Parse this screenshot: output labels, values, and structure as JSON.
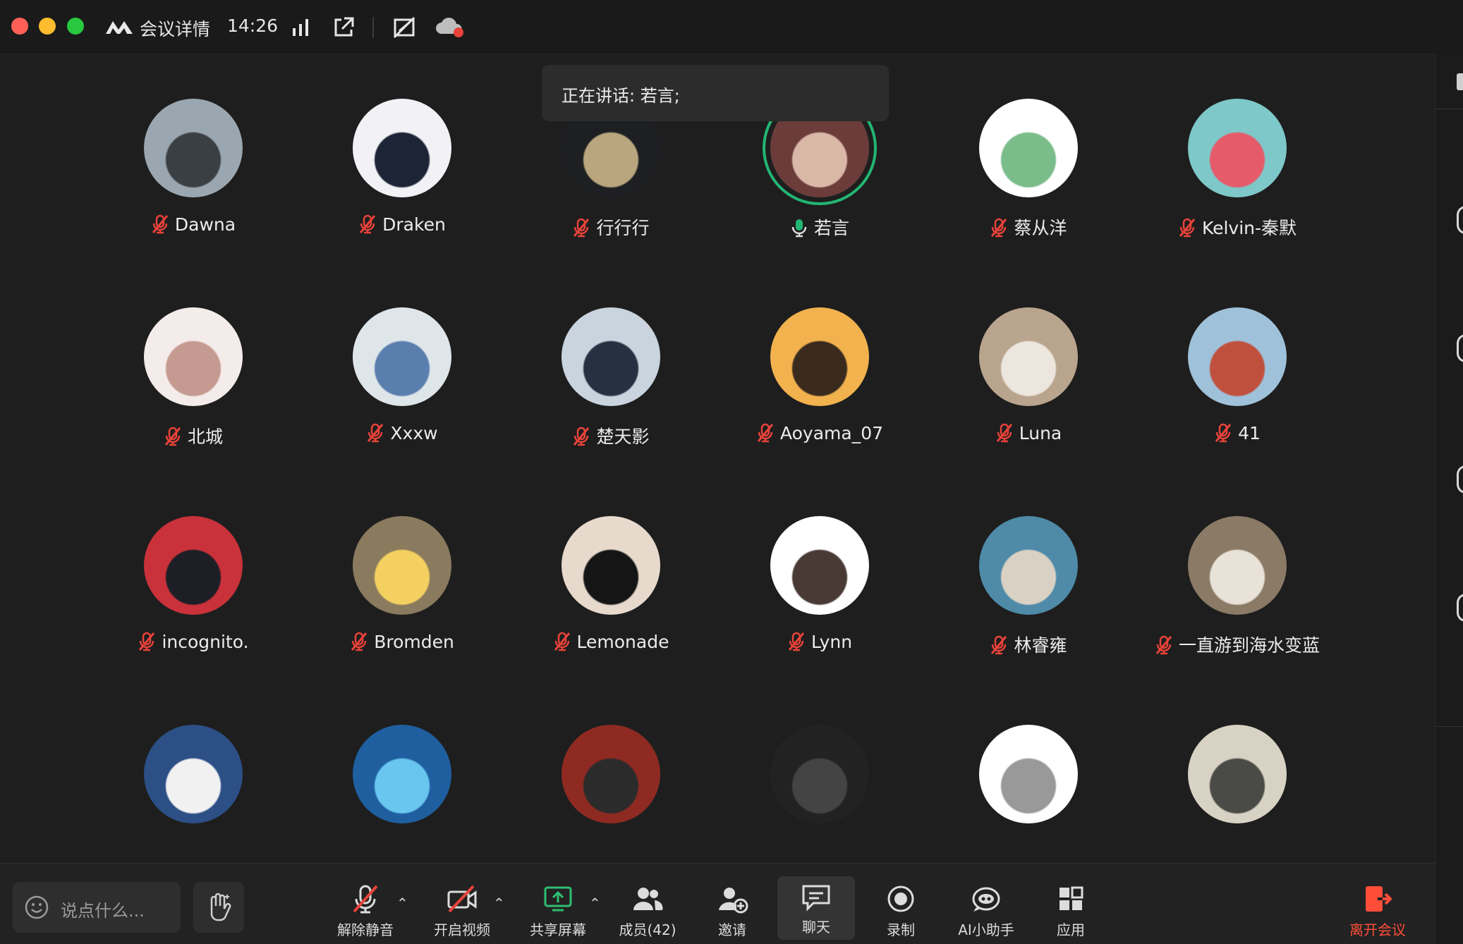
{
  "titlebar": {
    "title": "会议详情",
    "time": "14:26"
  },
  "speaking_banner": {
    "text": "正在讲话: 若言;"
  },
  "participants": [
    {
      "name": "Dawna",
      "mic": "muted",
      "avatar_colors": [
        "#9aa7b0",
        "#3a3f44"
      ]
    },
    {
      "name": "Draken",
      "mic": "muted",
      "avatar_colors": [
        "#f2f2f6",
        "#1d2436"
      ]
    },
    {
      "name": "行行行",
      "mic": "muted",
      "avatar_colors": [
        "#1d1f22",
        "#b9a67e"
      ]
    },
    {
      "name": "若言",
      "mic": "speaking",
      "avatar_colors": [
        "#6b3c3a",
        "#d9b8a8"
      ]
    },
    {
      "name": "蔡从洋",
      "mic": "muted",
      "avatar_colors": [
        "#ffffff",
        "#7bbd8a"
      ]
    },
    {
      "name": "Kelvin-秦默",
      "mic": "muted",
      "avatar_colors": [
        "#7ec8c9",
        "#e55b6a"
      ]
    },
    {
      "name": "北城",
      "mic": "muted",
      "avatar_colors": [
        "#f4ecea",
        "#c59a90"
      ]
    },
    {
      "name": "Xxxw",
      "mic": "muted",
      "avatar_colors": [
        "#dfe6ea",
        "#5a7fae"
      ]
    },
    {
      "name": "楚天影",
      "mic": "muted",
      "avatar_colors": [
        "#c9d4de",
        "#263040"
      ]
    },
    {
      "name": "Aoyama_07",
      "mic": "muted",
      "avatar_colors": [
        "#f2b24e",
        "#3a2a1e"
      ]
    },
    {
      "name": "Luna",
      "mic": "muted",
      "avatar_colors": [
        "#b9a48e",
        "#ece6de"
      ]
    },
    {
      "name": "41",
      "mic": "muted",
      "avatar_colors": [
        "#9fc1d9",
        "#c0503e"
      ]
    },
    {
      "name": "incognito.",
      "mic": "muted",
      "avatar_colors": [
        "#c9323a",
        "#1e1e26"
      ]
    },
    {
      "name": "Bromden",
      "mic": "muted",
      "avatar_colors": [
        "#8a7a5e",
        "#f4d060"
      ]
    },
    {
      "name": "Lemonade",
      "mic": "muted",
      "avatar_colors": [
        "#e7d9cc",
        "#151515"
      ]
    },
    {
      "name": "Lynn",
      "mic": "muted",
      "avatar_colors": [
        "#ffffff",
        "#4a3a36"
      ]
    },
    {
      "name": "林睿雍",
      "mic": "muted",
      "avatar_colors": [
        "#4f8aa8",
        "#d9d2c4"
      ]
    },
    {
      "name": "一直游到海水变蓝",
      "mic": "muted",
      "avatar_colors": [
        "#8a7a66",
        "#e8e2d8"
      ]
    },
    {
      "name": "",
      "mic": "none",
      "avatar_colors": [
        "#2c4f86",
        "#f1f1f1"
      ]
    },
    {
      "name": "",
      "mic": "none",
      "avatar_colors": [
        "#1f5fa0",
        "#68c6ef"
      ]
    },
    {
      "name": "",
      "mic": "none",
      "avatar_colors": [
        "#8e2a22",
        "#2b2b2b"
      ]
    },
    {
      "name": "",
      "mic": "none",
      "avatar_colors": [
        "#222222",
        "#444444"
      ]
    },
    {
      "name": "",
      "mic": "none",
      "avatar_colors": [
        "#ffffff",
        "#999999"
      ]
    },
    {
      "name": "",
      "mic": "none",
      "avatar_colors": [
        "#d8d2c4",
        "#4a4a46"
      ]
    }
  ],
  "toolbar": {
    "chat_placeholder": "说点什么...",
    "unmute": "解除静音",
    "start_video": "开启视频",
    "share_screen": "共享屏幕",
    "members": "成员(42)",
    "invite": "邀请",
    "chat": "聊天",
    "record": "录制",
    "ai_assistant": "AI小助手",
    "apps": "应用",
    "leave": "离开会议"
  },
  "colors": {
    "background": "#1e1e1e",
    "speaking_ring": "#22b573",
    "leave_red": "#ff4d3a",
    "muted_red": "#e8423a"
  }
}
